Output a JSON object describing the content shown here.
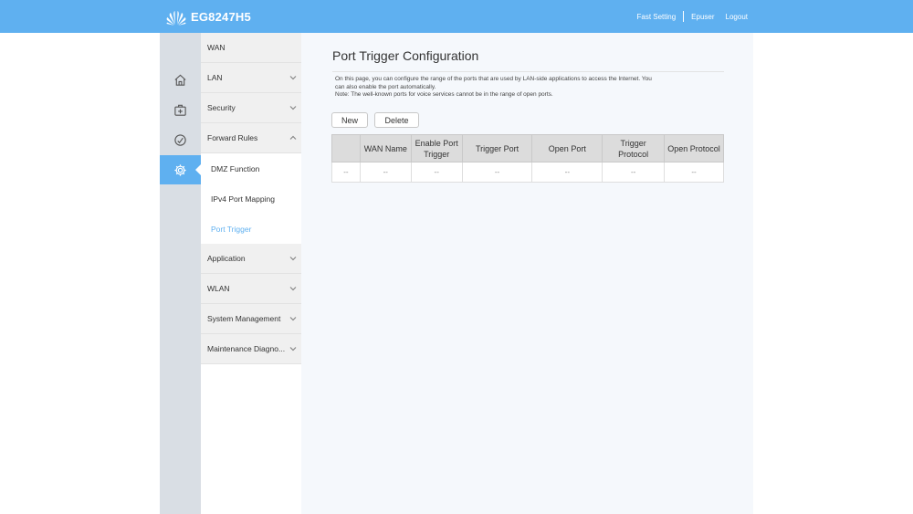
{
  "header": {
    "model": "EG8247H5",
    "links": [
      "Fast Setting",
      "Epuser",
      "Logout"
    ],
    "brand_color": "#5fb0f0"
  },
  "iconbar": {
    "icons": [
      "home-icon",
      "toolbox-icon",
      "gauge-icon",
      "gear-icon"
    ],
    "active_index": 3
  },
  "menu": {
    "items": [
      {
        "label": "WAN",
        "chevron": "none"
      },
      {
        "label": "LAN",
        "chevron": "down"
      },
      {
        "label": "Security",
        "chevron": "down"
      },
      {
        "label": "Forward Rules",
        "chevron": "up"
      }
    ],
    "subitems": [
      {
        "label": "DMZ Function"
      },
      {
        "label": "IPv4 Port Mapping"
      },
      {
        "label": "Port Trigger",
        "current": true
      }
    ],
    "items_after": [
      {
        "label": "Application",
        "chevron": "down"
      },
      {
        "label": "WLAN",
        "chevron": "down"
      },
      {
        "label": "System Management",
        "chevron": "down"
      },
      {
        "label": "Maintenance Diagno...",
        "chevron": "down"
      }
    ]
  },
  "main": {
    "title": "Port Trigger Configuration",
    "description_lines": [
      "On this page, you can configure the range of the ports that are used by LAN-side applications to access the Internet. You",
      "can also enable the port automatically.",
      "Note: The well-known ports for voice services cannot be in the range of open ports."
    ],
    "buttons": {
      "new": "New",
      "delete": "Delete"
    },
    "table": {
      "headers": [
        "",
        "WAN Name",
        "Enable Port Trigger",
        "Trigger Port",
        "Open Port",
        "Trigger Protocol",
        "Open Protocol"
      ],
      "rows": [
        [
          "--",
          "--",
          "--",
          "--",
          "--",
          "--",
          "--"
        ]
      ]
    }
  }
}
